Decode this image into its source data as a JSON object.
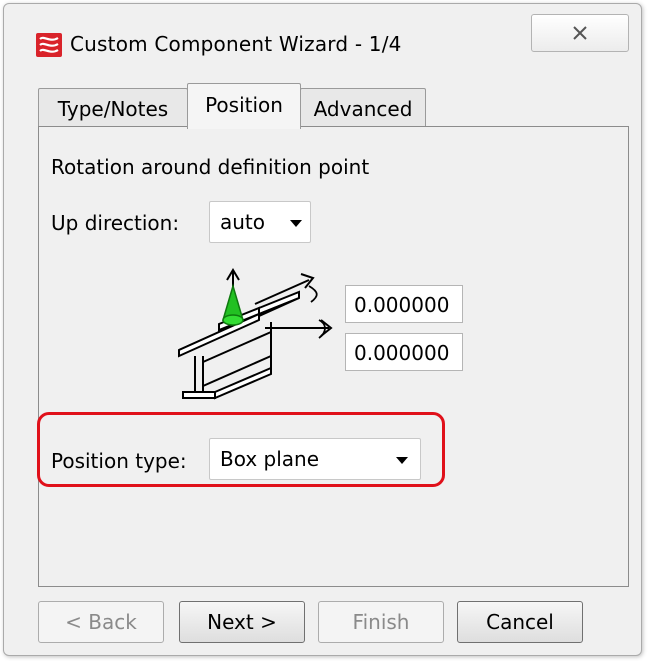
{
  "window": {
    "title": "Custom Component Wizard - 1/4"
  },
  "tabs": [
    {
      "label": "Type/Notes"
    },
    {
      "label": "Position"
    },
    {
      "label": "Advanced"
    }
  ],
  "position_tab": {
    "rotation_heading": "Rotation around definition point",
    "up_direction": {
      "label": "Up direction:",
      "value": "auto"
    },
    "rotation_values": [
      "0.000000",
      "0.000000"
    ],
    "position_type": {
      "label": "Position type:",
      "value": "Box plane"
    }
  },
  "buttons": {
    "back": "< Back",
    "next": "Next >",
    "finish": "Finish",
    "cancel": "Cancel"
  },
  "colors": {
    "highlight": "#e0101a",
    "cone": "#22c022"
  }
}
